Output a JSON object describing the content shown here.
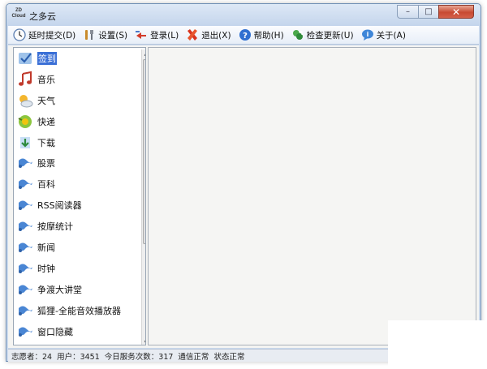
{
  "window": {
    "title": "之多云",
    "logo_text": "ZD Cloud",
    "buttons": {
      "minimize": "–",
      "maximize": "□",
      "close": "✕"
    }
  },
  "toolbar": {
    "items": [
      {
        "label": "延时提交(D)",
        "icon": "clock-icon"
      },
      {
        "label": "设置(S)",
        "icon": "tools-icon"
      },
      {
        "label": "登录(L)",
        "icon": "login-icon"
      },
      {
        "label": "退出(X)",
        "icon": "exit-icon"
      },
      {
        "label": "帮助(H)",
        "icon": "help-icon"
      },
      {
        "label": "检查更新(U)",
        "icon": "update-icon"
      },
      {
        "label": "关于(A)",
        "icon": "about-icon"
      }
    ]
  },
  "sidebar": {
    "selected_index": 0,
    "items": [
      {
        "label": "签到",
        "icon": "checkin-icon"
      },
      {
        "label": "音乐",
        "icon": "music-icon"
      },
      {
        "label": "天气",
        "icon": "weather-icon"
      },
      {
        "label": "快递",
        "icon": "delivery-icon"
      },
      {
        "label": "下载",
        "icon": "download-icon"
      },
      {
        "label": "股票",
        "icon": "plugin-icon"
      },
      {
        "label": "百科",
        "icon": "plugin-icon"
      },
      {
        "label": "RSS阅读器",
        "icon": "plugin-icon"
      },
      {
        "label": "按摩统计",
        "icon": "plugin-icon"
      },
      {
        "label": "新闻",
        "icon": "plugin-icon"
      },
      {
        "label": "时钟",
        "icon": "plugin-icon"
      },
      {
        "label": "争渡大讲堂",
        "icon": "plugin-icon"
      },
      {
        "label": "狐狸-全能音效播放器",
        "icon": "plugin-icon"
      },
      {
        "label": "窗口隐藏",
        "icon": "plugin-icon"
      }
    ]
  },
  "statusbar": {
    "volunteers": "志愿者：24",
    "users": "用户：3451",
    "today_count": "今日服务次数：317",
    "comm_status": "通信正常",
    "state_status": "状态正常"
  },
  "colors": {
    "selection": "#3a6fd6",
    "frame": "#c9d8ec"
  }
}
